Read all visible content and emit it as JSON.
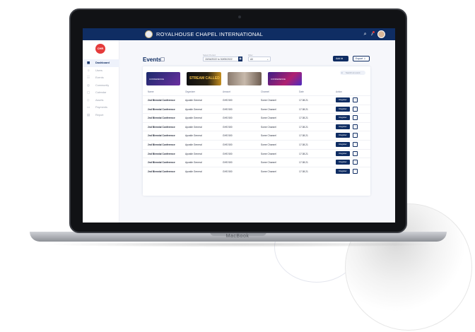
{
  "app": {
    "title": "ROYALHOUSE CHAPEL INTERNATIONAL",
    "brand_mark": "CHR"
  },
  "device": {
    "label": "MacBook"
  },
  "sidebar": {
    "items": [
      {
        "label": "Dashboard",
        "icon": "dashboard-icon",
        "glyph": "▦",
        "active": true
      },
      {
        "label": "Users",
        "icon": "users-icon",
        "glyph": "☺",
        "active": false
      },
      {
        "label": "Events",
        "icon": "events-icon",
        "glyph": "☷",
        "active": false
      },
      {
        "label": "Community",
        "icon": "community-icon",
        "glyph": "◎",
        "active": false
      },
      {
        "label": "Calendar",
        "icon": "calendar-icon",
        "glyph": "▢",
        "active": false
      },
      {
        "label": "Assets",
        "icon": "assets-icon",
        "glyph": "◇",
        "active": false
      },
      {
        "label": "Payments",
        "icon": "payments-icon",
        "glyph": "▭",
        "active": false
      },
      {
        "label": "Report",
        "icon": "report-icon",
        "glyph": "▤",
        "active": false
      }
    ]
  },
  "toolbar": {
    "page_title": "Events",
    "date_label": "Select Period",
    "date_value": "15/04/2022 to 30/05/2022",
    "filter_label": "Filter",
    "filter_value": "All",
    "add_label": "Add",
    "export_label": "Export"
  },
  "search": {
    "placeholder": "Search an event"
  },
  "banners": [
    {
      "text": "CONFERENCE"
    },
    {
      "text": "STREAM CALLED"
    },
    {
      "text": ""
    },
    {
      "text": "CONFERENCE"
    }
  ],
  "table": {
    "headers": [
      "Name",
      "Organizer",
      "Amount",
      "Channel",
      "Date",
      "Action"
    ],
    "register_label": "Register",
    "rows": [
      {
        "name": "2nd Biennial Conference",
        "organizer": "Apostle General",
        "amount": "GHS 500",
        "channel": "Some Channel",
        "date": "17.08.21"
      },
      {
        "name": "2nd Biennial Conference",
        "organizer": "Apostle General",
        "amount": "GHS 500",
        "channel": "Some Channel",
        "date": "17.08.21"
      },
      {
        "name": "2nd Biennial Conference",
        "organizer": "Apostle General",
        "amount": "GHS 500",
        "channel": "Some Channel",
        "date": "17.08.21"
      },
      {
        "name": "2nd Biennial Conference",
        "organizer": "Apostle General",
        "amount": "GHS 500",
        "channel": "Some Channel",
        "date": "17.08.21"
      },
      {
        "name": "2nd Biennial Conference",
        "organizer": "Apostle General",
        "amount": "GHS 500",
        "channel": "Some Channel",
        "date": "17.08.21"
      },
      {
        "name": "2nd Biennial Conference",
        "organizer": "Apostle General",
        "amount": "GHS 500",
        "channel": "Some Channel",
        "date": "17.08.21"
      },
      {
        "name": "2nd Biennial Conference",
        "organizer": "Apostle General",
        "amount": "GHS 500",
        "channel": "Some Channel",
        "date": "17.08.21"
      },
      {
        "name": "2nd Biennial Conference",
        "organizer": "Apostle General",
        "amount": "GHS 500",
        "channel": "Some Channel",
        "date": "17.08.21"
      },
      {
        "name": "2nd Biennial Conference",
        "organizer": "Apostle General",
        "amount": "GHS 500",
        "channel": "Some Channel",
        "date": "17.08.21"
      }
    ]
  },
  "colors": {
    "primary": "#0f2d63",
    "brand_red": "#e53b3b"
  }
}
